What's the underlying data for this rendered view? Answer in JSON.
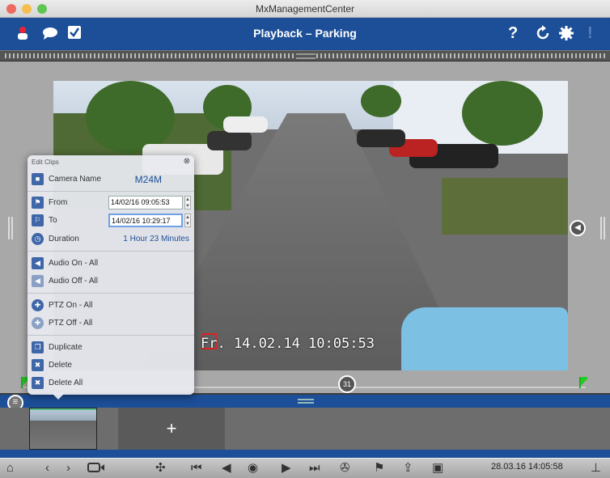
{
  "window": {
    "title": "MxManagementCenter"
  },
  "appbar": {
    "title": "Playback – Parking",
    "help_icon": "?"
  },
  "video": {
    "osd_text": "Fr. 14.02.14 10:05:53"
  },
  "edit_clips": {
    "header": "Edit Clips",
    "camera_name_label": "Camera Name",
    "camera_name_value": "M24M",
    "from_label": "From",
    "from_value": "14/02/16 09:05:53",
    "to_label": "To",
    "to_value": "14/02/16 10:29:17",
    "duration_label": "Duration",
    "duration_value": "1 Hour 23 Minutes",
    "audio_on": "Audio On - All",
    "audio_off": "Audio Off - All",
    "ptz_on": "PTZ On - All",
    "ptz_off": "PTZ Off - All",
    "duplicate": "Duplicate",
    "delete": "Delete",
    "delete_all": "Delete All"
  },
  "clips": {
    "add_label": "+"
  },
  "bottom": {
    "datetime": "28.03.16 14:05:58"
  },
  "colors": {
    "accent": "#1c4f97",
    "osd_box": "#dd2222",
    "flag": "#22aa22"
  }
}
